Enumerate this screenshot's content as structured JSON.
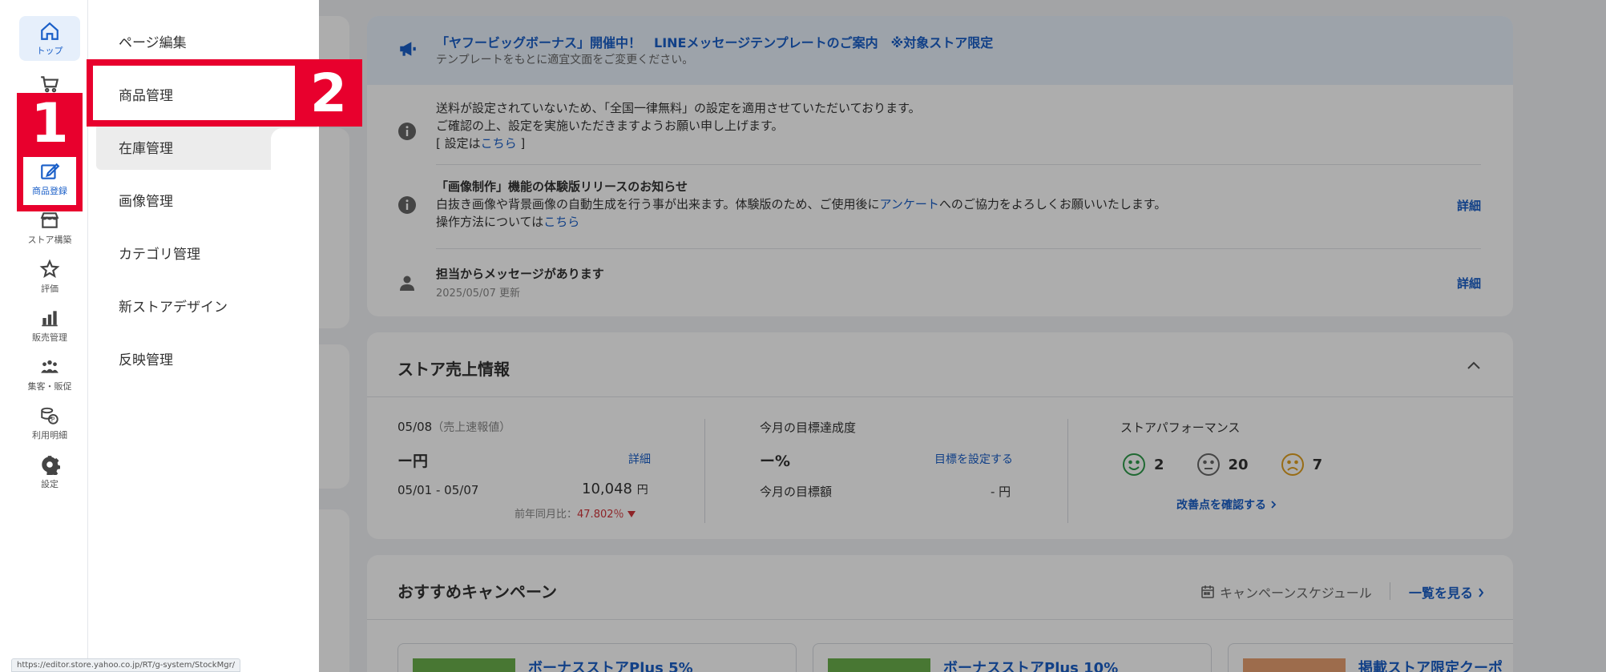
{
  "rail": {
    "items": [
      {
        "label": "トップ",
        "icon": "home-icon"
      },
      {
        "label": "",
        "icon": "cart-icon"
      },
      {
        "label": "商品登録",
        "icon": "edit-icon"
      },
      {
        "label": "ストア構築",
        "icon": "store-icon"
      },
      {
        "label": "評価",
        "icon": "star-icon"
      },
      {
        "label": "販売管理",
        "icon": "bar-chart-icon"
      },
      {
        "label": "集客・販促",
        "icon": "people-icon"
      },
      {
        "label": "利用明細",
        "icon": "coins-icon"
      },
      {
        "label": "設定",
        "icon": "gear-icon"
      }
    ]
  },
  "flyout": {
    "items": [
      "ページ編集",
      "商品管理",
      "在庫管理",
      "画像管理",
      "カテゴリ管理",
      "新ストアデザイン",
      "反映管理"
    ]
  },
  "annotations": {
    "step1": "1",
    "step2": "2"
  },
  "banner": {
    "title": "「ヤフービッグボーナス」開催中！　LINEメッセージテンプレートのご案内　※対象ストア限定",
    "subtitle": "テンプレートをもとに適宜文面をご変更ください。"
  },
  "notices": [
    {
      "line1": "送料が設定されていないため、「全国一律無料」の設定を適用させていただいております。",
      "line2": "ご確認の上、設定を実施いただきますようお願い申し上げます。",
      "line3_prefix": "[ 設定は",
      "line3_link": "こちら",
      "line3_suffix": " ]"
    },
    {
      "title": "「画像制作」機能の体験版リリースのお知らせ",
      "line1_prefix": "白抜き画像や背景画像の自動生成を行う事が出来ます。体験版のため、ご使用後に",
      "line1_link": "アンケート",
      "line1_suffix": "へのご協力をよろしくお願いいたします。",
      "line2_prefix": "操作方法については",
      "line2_link": "こちら",
      "action": "詳細"
    },
    {
      "title": "担当からメッセージがあります",
      "date": "2025/05/07 更新",
      "action": "詳細"
    }
  ],
  "sales": {
    "title": "ストア売上情報",
    "date": "05/08",
    "date_note": "（売上速報値）",
    "today_value": "ー円",
    "detail": "詳細",
    "period": "05/01 - 05/07",
    "period_value": "10,048",
    "yen": "円",
    "yoy_label": "前年同月比：",
    "yoy_value": "47.802％",
    "target_title": "今月の目標達成度",
    "target_value": "ー%",
    "target_link": "目標を設定する",
    "target_amount_label": "今月の目標額",
    "target_amount_value": "- 円",
    "perf_title": "ストアパフォーマンス",
    "perf_good": "2",
    "perf_neutral": "20",
    "perf_bad": "7",
    "perf_link": "改善点を確認する",
    "colors": {
      "good": "#2e9b4a",
      "neutral": "#666666",
      "bad": "#e0a020",
      "down": "#d0343a"
    }
  },
  "campaign": {
    "title": "おすすめキャンペーン",
    "schedule": "キャンペーンスケジュール",
    "view_all": "一覧を見る",
    "items": [
      "ボーナスストアPlus 5%",
      "ボーナスストアPlus 10%",
      "掲載ストア限定クーポ"
    ]
  },
  "status_url": "https://editor.store.yahoo.co.jp/RT/g-system/StockMgr/"
}
